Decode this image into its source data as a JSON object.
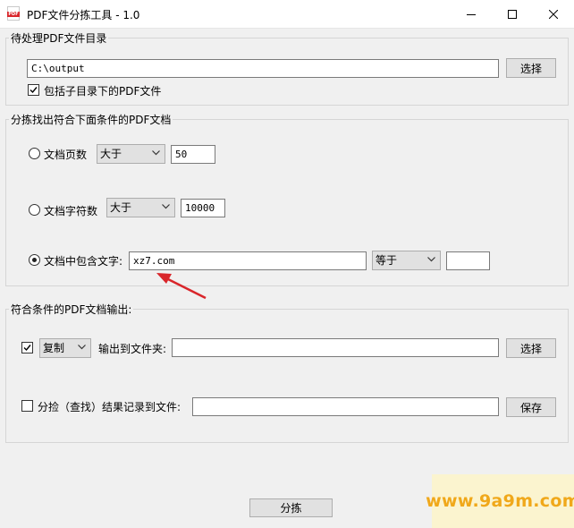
{
  "window": {
    "title": "PDF文件分拣工具 - 1.0",
    "app_icon_text": "PDF"
  },
  "source": {
    "group_title": "待处理PDF文件目录",
    "path_value": "C:\\output",
    "browse_label": "选择",
    "include_subdirs_label": "包括子目录下的PDF文件",
    "include_subdirs_checked": true
  },
  "conditions": {
    "group_title": "分拣找出符合下面条件的PDF文档",
    "page_count": {
      "label": "文档页数",
      "operator": "大于",
      "value": "50",
      "selected": false
    },
    "char_count": {
      "label": "文档字符数",
      "operator": "大于",
      "value": "10000",
      "selected": false
    },
    "contains_text": {
      "label": "文档中包含文字:",
      "value": "xz7.com",
      "operator": "等于",
      "extra_value": "",
      "selected": true
    }
  },
  "output": {
    "group_title": "符合条件的PDF文档输出:",
    "copy_checked": true,
    "mode": "复制",
    "folder_label": "输出到文件夹:",
    "folder_value": "",
    "browse_label": "选择",
    "log_checked": false,
    "log_label": "分捡（查找）结果记录到文件:",
    "log_value": "",
    "save_label": "保存"
  },
  "action": {
    "sort_label": "分拣"
  },
  "watermark": {
    "text": "www.9a9m.com"
  },
  "colors": {
    "arrow": "#d9262b",
    "watermark": "#f0a81a",
    "app_icon": "#d9262b"
  }
}
